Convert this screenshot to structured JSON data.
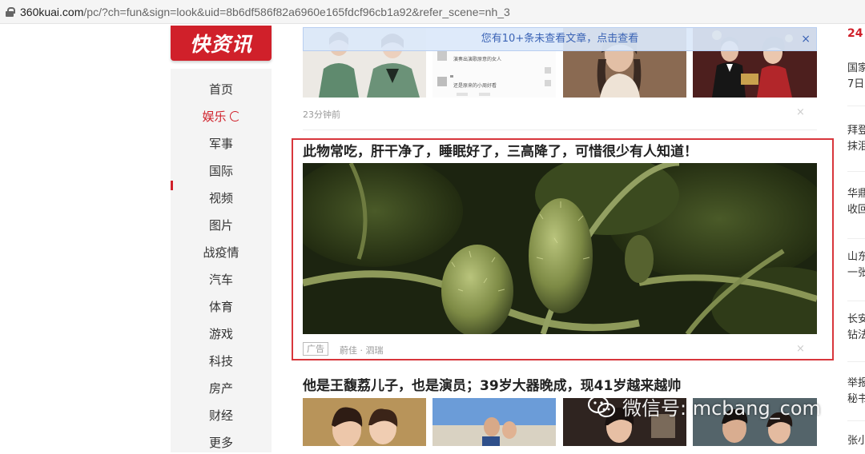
{
  "browser": {
    "url_host": "360kuai.com",
    "url_path": "/pc/?ch=fun&sign=look&uid=8b6df586f82a6960e165fdcf96cb1a92&refer_scene=nh_3"
  },
  "logo": {
    "text": "快资讯"
  },
  "nav": {
    "items": [
      {
        "label": "首页"
      },
      {
        "label": "娱乐",
        "active": true
      },
      {
        "label": "军事"
      },
      {
        "label": "国际"
      },
      {
        "label": "视频"
      },
      {
        "label": "图片"
      },
      {
        "label": "战疫情"
      },
      {
        "label": "汽车"
      },
      {
        "label": "体育"
      },
      {
        "label": "游戏"
      },
      {
        "label": "科技"
      },
      {
        "label": "房产"
      },
      {
        "label": "财经"
      },
      {
        "label": "更多"
      }
    ]
  },
  "notice": {
    "text": "您有10+条未查看文章，点击查看",
    "close": "×"
  },
  "feed": {
    "item1": {
      "time": "23分钟前",
      "close": "×",
      "chat_lines": [
        "演奏出演歌原意的女人",
        "还是原来的小周好看"
      ]
    },
    "ad": {
      "title": "此物常吃，肝干净了，睡眠好了，三高降了，可惜很少有人知道！",
      "tag": "广告",
      "source": "蔚佳 · 泗瑞",
      "close": "×"
    },
    "item3": {
      "title": "他是王馥荔儿子，也是演员；39岁大器晚成，现41岁越来越帅"
    }
  },
  "watermark": {
    "text": "微信号: mcbang_com"
  },
  "rail": {
    "title": "24",
    "lines": [
      "国家",
      "7日",
      "拜登",
      "抹泪",
      "华鼎",
      "收回",
      "山东",
      "一张",
      "长安",
      "钻法",
      "举报",
      "秘书",
      "张小"
    ]
  },
  "colors": {
    "brand_red": "#d0202a",
    "notice_blue": "#3a63b5",
    "ad_highlight": "#d8363c"
  }
}
